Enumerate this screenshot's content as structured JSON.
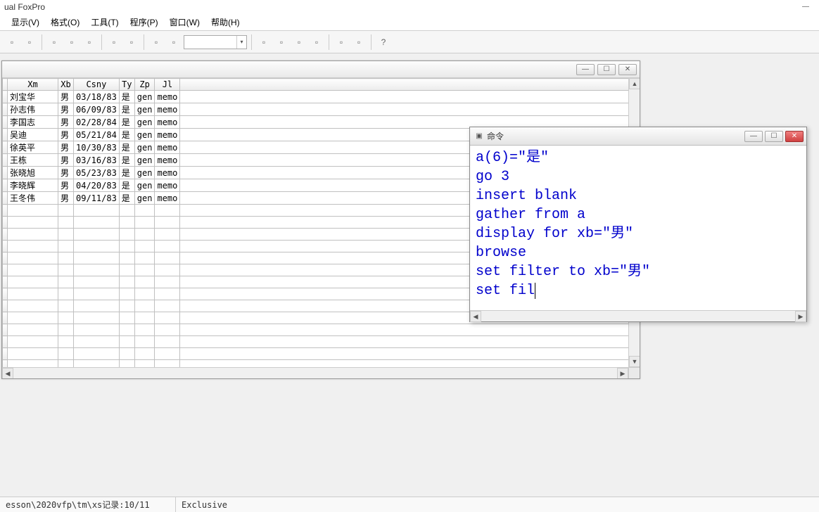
{
  "app_title": "ual FoxPro",
  "menu": [
    "显示(V)",
    "格式(O)",
    "工具(T)",
    "程序(P)",
    "窗口(W)",
    "帮助(H)"
  ],
  "toolbar_icons": [
    {
      "name": "new-icon"
    },
    {
      "name": "open-icon"
    },
    {
      "sep": true
    },
    {
      "name": "cut-icon"
    },
    {
      "name": "copy-icon"
    },
    {
      "name": "paste-icon"
    },
    {
      "sep": true
    },
    {
      "name": "undo-icon"
    },
    {
      "name": "redo-icon"
    },
    {
      "sep": true
    },
    {
      "name": "run-icon"
    },
    {
      "name": "modify-icon"
    },
    {
      "combo": true
    },
    {
      "sep": true
    },
    {
      "name": "form-icon"
    },
    {
      "name": "report-icon"
    },
    {
      "name": "label-icon"
    },
    {
      "name": "database-icon"
    },
    {
      "sep": true
    },
    {
      "name": "autoformat-icon"
    },
    {
      "name": "builder-icon"
    },
    {
      "sep": true
    },
    {
      "name": "help-icon",
      "glyph": "?"
    }
  ],
  "browse": {
    "columns": [
      "Xm",
      "Xb",
      "Csny",
      "Ty",
      "Zp",
      "Jl"
    ],
    "rows": [
      {
        "Xm": "刘宝华",
        "Xb": "男",
        "Csny": "03/18/83",
        "Ty": "是",
        "Zp": "gen",
        "Jl": "memo"
      },
      {
        "Xm": "孙志伟",
        "Xb": "男",
        "Csny": "06/09/83",
        "Ty": "是",
        "Zp": "gen",
        "Jl": "memo"
      },
      {
        "Xm": "李国志",
        "Xb": "男",
        "Csny": "02/28/84",
        "Ty": "是",
        "Zp": "gen",
        "Jl": "memo"
      },
      {
        "Xm": "吴迪",
        "Xb": "男",
        "Csny": "05/21/84",
        "Ty": "是",
        "Zp": "gen",
        "Jl": "memo"
      },
      {
        "Xm": "徐英平",
        "Xb": "男",
        "Csny": "10/30/83",
        "Ty": "是",
        "Zp": "gen",
        "Jl": "memo"
      },
      {
        "Xm": "王栋",
        "Xb": "男",
        "Csny": "03/16/83",
        "Ty": "是",
        "Zp": "gen",
        "Jl": "memo"
      },
      {
        "Xm": "张晓旭",
        "Xb": "男",
        "Csny": "05/23/83",
        "Ty": "是",
        "Zp": "gen",
        "Jl": "memo"
      },
      {
        "Xm": "李晓辉",
        "Xb": "男",
        "Csny": "04/20/83",
        "Ty": "是",
        "Zp": "gen",
        "Jl": "memo"
      },
      {
        "Xm": "王冬伟",
        "Xb": "男",
        "Csny": "09/11/83",
        "Ty": "是",
        "Zp": "gen",
        "Jl": "memo"
      }
    ],
    "empty_rows": 15
  },
  "command_window": {
    "title": "命令",
    "lines": [
      "a(6)=\"是\"",
      "go 3",
      "insert blank",
      "gather from a",
      "display for xb=\"男\"",
      "browse",
      "set filter to xb=\"男\"",
      "set fil"
    ]
  },
  "statusbar": {
    "left": "esson\\2020vfp\\tm\\xs记录:10/11",
    "mode": "Exclusive"
  }
}
